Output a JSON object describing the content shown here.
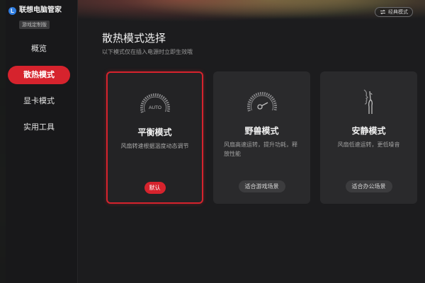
{
  "app": {
    "logo_letter": "L",
    "name": "联想电脑管家",
    "badge": "游戏定制版",
    "classic_mode_label": "经典模式"
  },
  "sidebar": {
    "items": [
      {
        "label": "概览",
        "active": false
      },
      {
        "label": "散热模式",
        "active": true
      },
      {
        "label": "显卡模式",
        "active": false
      },
      {
        "label": "实用工具",
        "active": false
      }
    ]
  },
  "main": {
    "title": "散热模式选择",
    "subtitle": "以下模式仅在插入电源时立即生效哦",
    "cards": [
      {
        "name": "平衡模式",
        "desc": "风扇转速根据温度动态调节",
        "tag": "默认",
        "icon": "auto-gauge-icon",
        "icon_text": "AUTO",
        "selected": true
      },
      {
        "name": "野兽模式",
        "desc": "风扇高速运转，提升功耗，释放性能",
        "tag": "适合游戏场景",
        "icon": "high-speed-gauge-icon",
        "selected": false
      },
      {
        "name": "安静模式",
        "desc": "风扇低速运转，更低噪音",
        "tag": "适合办公场景",
        "icon": "quiet-finger-icon",
        "selected": false
      }
    ]
  },
  "colors": {
    "accent": "#d6232d",
    "background": "#1b1b1d",
    "card": "#2a2a2c"
  }
}
